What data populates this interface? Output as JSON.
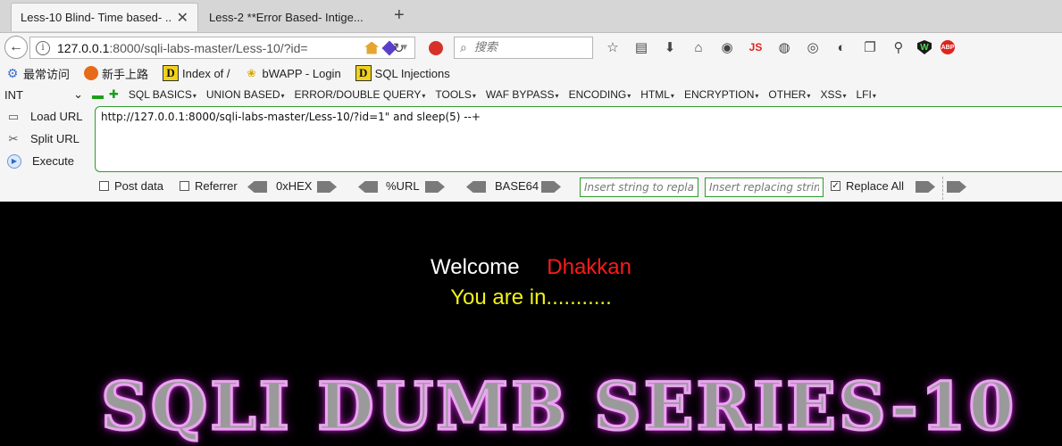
{
  "tabs": [
    {
      "title": "Less-10 Blind- Time based- ...",
      "active": true
    },
    {
      "title": "Less-2 **Error Based- Intige...",
      "active": false
    }
  ],
  "navbar": {
    "url_host": "127.0.0.1",
    "url_rest": ":8000/sqli-labs-master/Less-10/?id=",
    "search_placeholder": "搜索"
  },
  "bookmarks": [
    {
      "label": "最常访问",
      "icon": "gear-icon"
    },
    {
      "label": "新手上路",
      "icon": "firefox-icon"
    },
    {
      "label": "Index of /",
      "icon": "d-icon"
    },
    {
      "label": "bWAPP - Login",
      "icon": "bee-icon"
    },
    {
      "label": "SQL Injections",
      "icon": "d-icon"
    }
  ],
  "hackbar": {
    "type_select": "INT",
    "menus": [
      "SQL BASICS",
      "UNION BASED",
      "ERROR/DOUBLE QUERY",
      "TOOLS",
      "WAF BYPASS",
      "ENCODING",
      "HTML",
      "ENCRYPTION",
      "OTHER",
      "XSS",
      "LFI"
    ],
    "load_url": "Load URL",
    "split_url": "Split URL",
    "execute": "Execute",
    "url_value": "http://127.0.0.1:8000/sqli-labs-master/Less-10/?id=1\" and sleep(5) --+",
    "post_data": "Post data",
    "referrer": "Referrer",
    "hex": "0xHEX",
    "url_enc": "%URL",
    "base64": "BASE64",
    "insert_placeholder": "Insert string to replace",
    "replacing_placeholder": "Insert replacing string",
    "replace_all": "Replace All",
    "post_data_checked": false,
    "referrer_checked": false,
    "replace_all_checked": true
  },
  "page": {
    "welcome": "Welcome",
    "name": "Dhakkan",
    "status": "You are in...........",
    "banner": "SQLI DUMB SERIES-10"
  },
  "colors": {
    "welcome": "#ffffff",
    "name": "#ff1a1a",
    "status": "#f2f21a",
    "banner_glow": "#d52dde",
    "accent_green": "#2e9b2e"
  }
}
